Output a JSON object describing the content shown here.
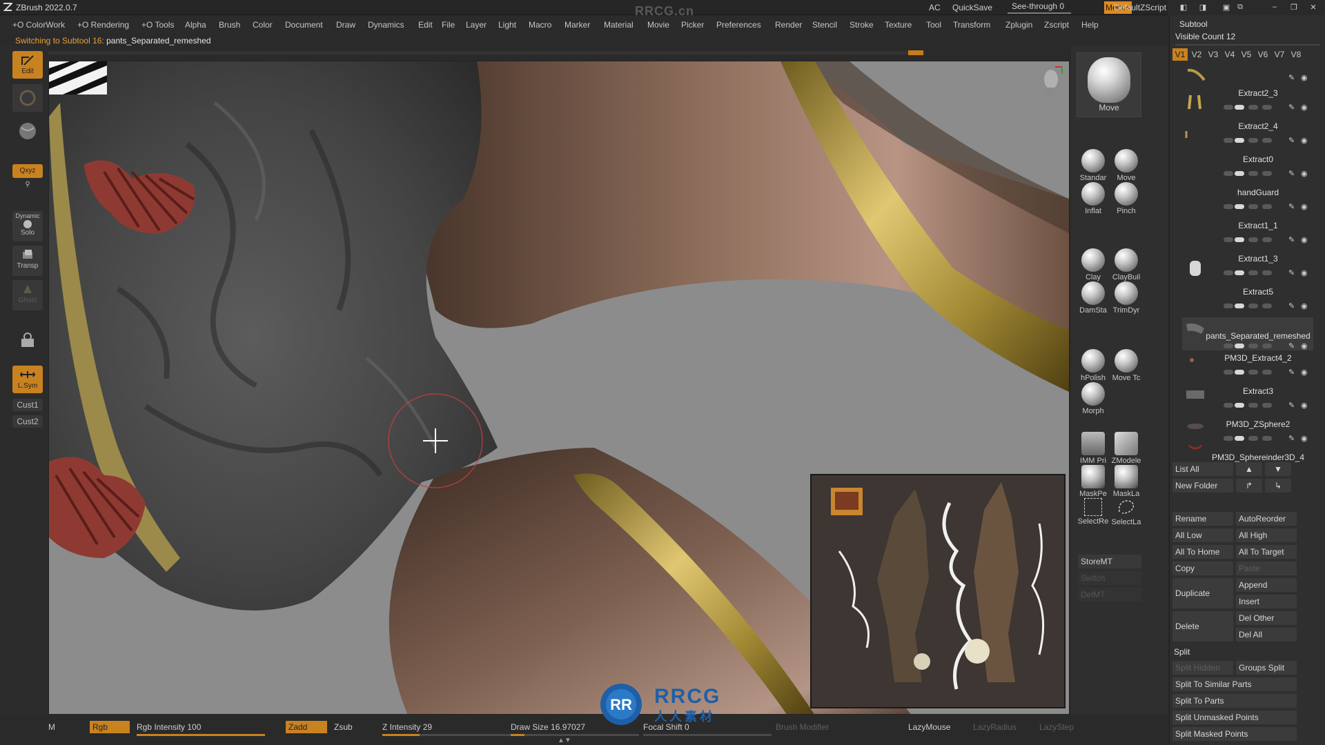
{
  "titlebar": {
    "app_title": "ZBrush 2022.0.7",
    "watermark": "RRCG.cn",
    "ac": "AC",
    "quicksave": "QuickSave",
    "see_through": "See-through  0",
    "menus": "Menus",
    "default_zscript": "DefaultZScript"
  },
  "menu": {
    "items": [
      "+O ColorWork",
      "+O Rendering",
      "+O Tools",
      "Alpha",
      "Brush",
      "Color",
      "Document",
      "Draw",
      "Dynamics",
      "Edit",
      "File",
      "Layer",
      "Light",
      "Macro",
      "Marker",
      "Material",
      "Movie",
      "Picker",
      "Preferences",
      "Render",
      "Stencil",
      "Stroke",
      "Texture",
      "Tool",
      "Transform",
      "Zplugin",
      "Zscript",
      "Help"
    ]
  },
  "notice": {
    "prefix": "Switching to Subtool 16:",
    "name": "pants_Separated_remeshed"
  },
  "left_shelf": {
    "edit": "Edit",
    "xyz": "Qxyz",
    "dynamic": "Dynamic",
    "solo": "Solo",
    "transp": "Transp",
    "ghost": "Ghost",
    "lsym": "L.Sym",
    "cust1": "Cust1",
    "cust2": "Cust2"
  },
  "brushes": {
    "current": "Move",
    "items": [
      "Standar",
      "Move",
      "Inflat",
      "Pinch",
      "Clay",
      "ClayBuil",
      "DamSta",
      "TrimDyr",
      "hPolish",
      "Move Tc",
      "Morph",
      "IMM Pri",
      "ZModele",
      "MaskPe",
      "MaskLa",
      "SelectRe",
      "SelectLa"
    ],
    "mt_buttons": [
      "StoreMT",
      "Switch",
      "DelMT"
    ]
  },
  "subtool": {
    "title": "Subtool",
    "visible_count": "Visible Count 12",
    "versions": [
      "V1",
      "V2",
      "V3",
      "V4",
      "V5",
      "V6",
      "V7",
      "V8"
    ],
    "items": [
      "Extract2_3",
      "Extract2_4",
      "Extract0",
      "handGuard",
      "Extract1_1",
      "Extract1_3",
      "Extract5",
      "pants_Separated_remeshed",
      "PM3D_Extract4_2",
      "Extract3",
      "PM3D_ZSphere2",
      "PM3D_Sphereinder3D_4"
    ],
    "list_all": "List All",
    "new_folder": "New Folder",
    "rename": "Rename",
    "autoreorder": "AutoReorder",
    "all_low": "All Low",
    "all_high": "All High",
    "all_to_home": "All To Home",
    "all_to_target": "All To Target",
    "copy": "Copy",
    "paste": "Paste",
    "duplicate": "Duplicate",
    "append": "Append",
    "insert": "Insert",
    "delete": "Delete",
    "del_other": "Del Other",
    "del_all": "Del All",
    "split": "Split",
    "split_hidden": "Split Hidden",
    "groups_split": "Groups Split",
    "split_similar": "Split To Similar Parts",
    "split_parts": "Split To Parts",
    "split_unmasked": "Split Unmasked Points",
    "split_masked": "Split Masked Points"
  },
  "bottom": {
    "m": "M",
    "rgb": "Rgb",
    "rgb_intensity": "Rgb Intensity 100",
    "zadd": "Zadd",
    "zsub": "Zsub",
    "z_intensity": "Z Intensity 29",
    "draw_size": "Draw Size 16.97027",
    "focal_shift": "Focal Shift 0",
    "brush_modifier": "Brush Modifier",
    "lazymouse": "LazyMouse",
    "lazyradius": "LazyRadius",
    "lazystep": "LazyStep",
    "rgb_intensity_value": 100,
    "z_intensity_value": 29,
    "draw_size_value": 16.97027
  },
  "watermark": {
    "brand": "RRCG",
    "sub": "人人素材"
  },
  "colors": {
    "accent": "#c88220",
    "panel": "#2f2f2f",
    "viewport_bg": "#8c8c8c"
  }
}
